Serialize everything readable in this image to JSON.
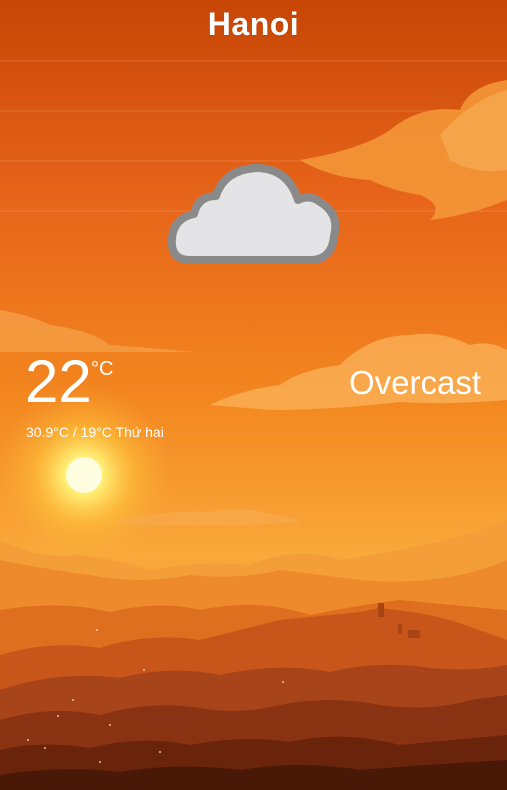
{
  "location": {
    "city": "Hanoi"
  },
  "current": {
    "temperature": "22",
    "unit": "°C",
    "condition": "Overcast",
    "range_and_day": "30.9°C / 19°C Thứ hai",
    "icon": "cloud-icon"
  },
  "colors": {
    "sky_top": "#c84606",
    "sky_mid": "#f07a1c",
    "sky_low": "#f9a83a",
    "mountain_dark": "#4a1806"
  }
}
